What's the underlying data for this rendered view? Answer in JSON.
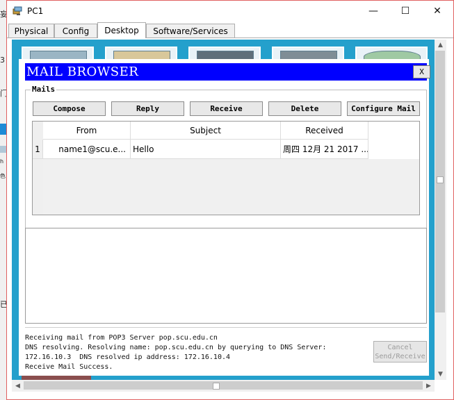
{
  "window": {
    "title": "PC1",
    "minimize_glyph": "—",
    "maximize_glyph": "☐",
    "close_glyph": "✕",
    "icon": "network-pc-icon"
  },
  "tabs": [
    {
      "label": "Physical"
    },
    {
      "label": "Config"
    },
    {
      "label": "Desktop",
      "active": true
    },
    {
      "label": "Software/Services"
    }
  ],
  "left_strip": [
    "妄",
    "3",
    "门",
    "h",
    "色",
    "已"
  ],
  "mail_browser": {
    "title": "MAIL BROWSER",
    "close_label": "X",
    "mails_group_label": "Mails",
    "buttons": {
      "compose": "Compose",
      "reply": "Reply",
      "receive": "Receive",
      "delete": "Delete",
      "configure": "Configure Mail"
    },
    "table": {
      "headers": {
        "from": "From",
        "subject": "Subject",
        "received": "Received"
      },
      "rows": [
        {
          "num": "1",
          "from": "name1@scu.e...",
          "subject": "Hello",
          "received": "周四 12月 21 2017 ..."
        }
      ]
    },
    "status": {
      "lines": [
        "Receiving mail from POP3 Server pop.scu.edu.cn",
        "DNS resolving. Resolving name: pop.scu.edu.cn by querying to DNS Server:",
        "172.16.10.3  DNS resolved ip address: 172.16.10.4",
        "Receive Mail Success."
      ],
      "cancel_line1": "Cancel",
      "cancel_line2": "Send/Receive"
    }
  },
  "colors": {
    "mail_title_bar": "#0000ff",
    "desktop_background": "#24a0cc",
    "window_border": "#e06060"
  }
}
